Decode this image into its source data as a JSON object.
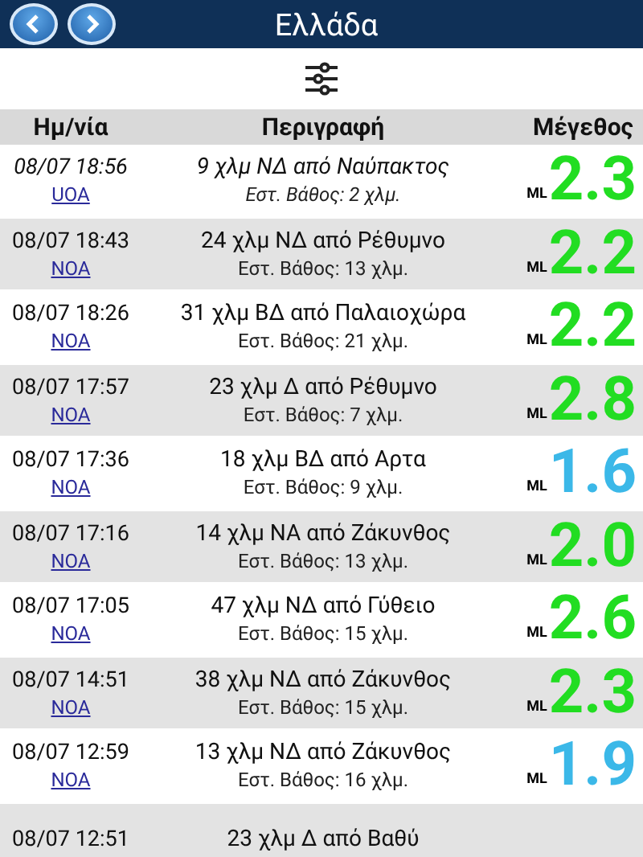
{
  "header": {
    "title": "Ελλάδα"
  },
  "columns": [
    "Ημ/νία",
    "Περιγραφή",
    "Μέγεθος"
  ],
  "rows": [
    {
      "time": "08/07 18:56",
      "source": "UOA",
      "place": "9 χλμ ΝΔ από Ναύπακτος",
      "depth": "Εστ. Βάθος: 2 χλμ.",
      "scale": "ML",
      "magnitude": "2.3",
      "color": "#22dd22"
    },
    {
      "time": "08/07 18:43",
      "source": "NOA",
      "place": "24 χλμ ΝΔ από Ρέθυμνο",
      "depth": "Εστ. Βάθος: 13 χλμ.",
      "scale": "ML",
      "magnitude": "2.2",
      "color": "#22dd22"
    },
    {
      "time": "08/07 18:26",
      "source": "NOA",
      "place": "31 χλμ ΒΔ από Παλαιοχώρα",
      "depth": "Εστ. Βάθος: 21 χλμ.",
      "scale": "ML",
      "magnitude": "2.2",
      "color": "#22dd22"
    },
    {
      "time": "08/07 17:57",
      "source": "NOA",
      "place": "23 χλμ Δ από Ρέθυμνο",
      "depth": "Εστ. Βάθος: 7 χλμ.",
      "scale": "ML",
      "magnitude": "2.8",
      "color": "#22dd22"
    },
    {
      "time": "08/07 17:36",
      "source": "NOA",
      "place": "18 χλμ ΒΔ από Αρτα",
      "depth": "Εστ. Βάθος: 9 χλμ.",
      "scale": "ML",
      "magnitude": "1.6",
      "color": "#3bb8e8"
    },
    {
      "time": "08/07 17:16",
      "source": "NOA",
      "place": "14 χλμ ΝΑ από Ζάκυνθος",
      "depth": "Εστ. Βάθος: 13 χλμ.",
      "scale": "ML",
      "magnitude": "2.0",
      "color": "#22dd22"
    },
    {
      "time": "08/07 17:05",
      "source": "NOA",
      "place": "47 χλμ ΝΔ από Γύθειο",
      "depth": "Εστ. Βάθος: 15 χλμ.",
      "scale": "ML",
      "magnitude": "2.6",
      "color": "#22dd22"
    },
    {
      "time": "08/07 14:51",
      "source": "NOA",
      "place": "38 χλμ ΝΔ από Ζάκυνθος",
      "depth": "Εστ. Βάθος: 15 χλμ.",
      "scale": "ML",
      "magnitude": "2.3",
      "color": "#22dd22"
    },
    {
      "time": "08/07 12:59",
      "source": "NOA",
      "place": "13 χλμ ΝΔ από Ζάκυνθος",
      "depth": "Εστ. Βάθος: 16 χλμ.",
      "scale": "ML",
      "magnitude": "1.9",
      "color": "#3bb8e8"
    },
    {
      "time": "08/07 12:51",
      "place": "23 χλμ Δ από Βαθύ"
    }
  ]
}
